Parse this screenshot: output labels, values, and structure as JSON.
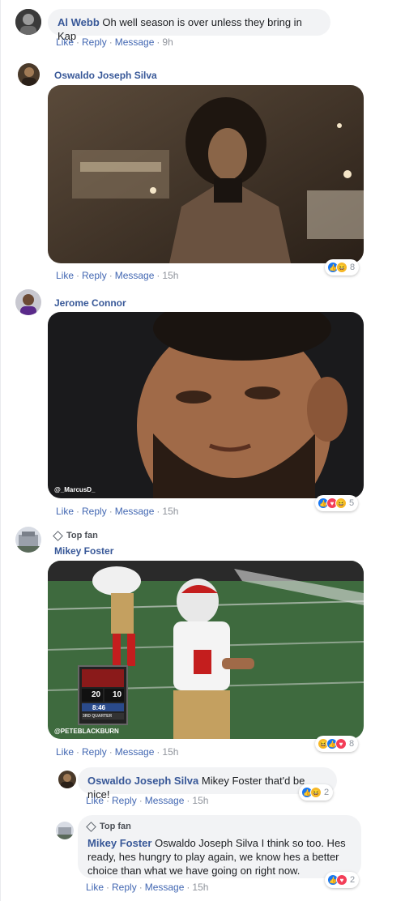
{
  "actions": {
    "like": "Like",
    "reply": "Reply",
    "message": "Message"
  },
  "comments": [
    {
      "author": "Al Webb",
      "text": "Oh well season is over unless they bring in Kap",
      "time": "9h"
    },
    {
      "author": "Oswaldo Joseph Silva",
      "time": "15h",
      "reaction_count": "8",
      "reactions": [
        "like-icon",
        "haha-icon"
      ]
    },
    {
      "author": "Jerome Connor",
      "time": "15h",
      "reaction_count": "5",
      "reactions": [
        "like-icon",
        "love-icon",
        "haha-icon"
      ],
      "gif_watermark": "@_MarcusD_"
    },
    {
      "badge": "Top fan",
      "author": "Mikey Foster",
      "time": "15h",
      "reaction_count": "8",
      "reactions": [
        "haha-icon",
        "like-icon",
        "love-icon"
      ],
      "gif_watermark": "@PETEBLACKBURN",
      "scoreboard": {
        "score_left": "20",
        "score_right": "10",
        "clock": "8:46",
        "period": "3RD QUARTER"
      }
    }
  ],
  "replies": [
    {
      "author": "Oswaldo Joseph Silva",
      "text": "Mikey Foster that'd be nice!",
      "time": "15h",
      "reaction_count": "2",
      "reactions": [
        "like-icon",
        "haha-icon"
      ]
    },
    {
      "badge": "Top fan",
      "author": "Mikey Foster",
      "text": "Oswaldo Joseph Silva I think so too. Hes ready, hes hungry to play again, we know hes a better choice than what we have going on right now.",
      "time": "15h",
      "reaction_count": "2",
      "reactions": [
        "like-icon",
        "love-icon"
      ]
    }
  ],
  "colors": {
    "link": "#385898",
    "action": "#4267b2",
    "bubble": "#f2f3f5",
    "meta": "#90949c"
  }
}
